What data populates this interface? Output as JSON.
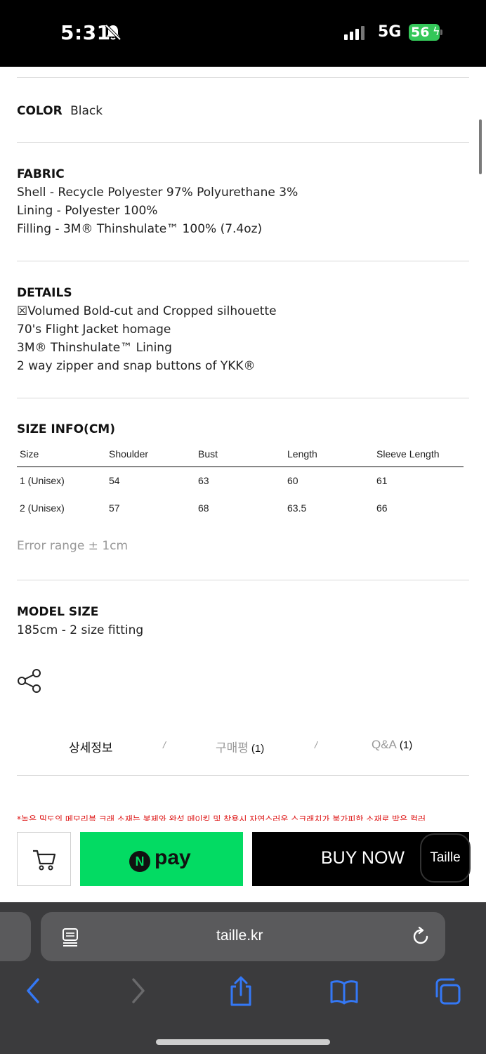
{
  "status_bar": {
    "time": "5:31",
    "network": "5G",
    "battery": "56"
  },
  "product": {
    "color_label": "COLOR",
    "color_value": "Black",
    "fabric": {
      "label": "FABRIC",
      "lines": [
        "Shell - Recycle Polyester 97% Polyurethane 3%",
        "Lining - Polyester 100%",
        "Filling - 3M® Thinshulate™ 100% (7.4oz)"
      ]
    },
    "details": {
      "label": "DETAILS",
      "lines": [
        "☒Volumed Bold-cut and Cropped silhouette",
        "70's Flight Jacket homage",
        "3M® Thinshulate™ Lining",
        "2 way zipper and snap buttons of YKK®"
      ]
    },
    "size_info": {
      "label": "SIZE INFO(CM)",
      "headers": [
        "Size",
        "Shoulder",
        "Bust",
        "Length",
        "Sleeve Length"
      ],
      "rows": [
        [
          "1 (Unisex)",
          "54",
          "63",
          "60",
          "61"
        ],
        [
          "2 (Unisex)",
          "57",
          "68",
          "63.5",
          "66"
        ]
      ],
      "note": "Error range ± 1cm"
    },
    "model_size": {
      "label": "MODEL SIZE",
      "value": "185cm - 2 size fitting"
    }
  },
  "tabs": {
    "detail": "상세정보",
    "review": "구매평",
    "review_count": "(1)",
    "qa": "Q&A",
    "qa_count": "(1)",
    "separator": "/"
  },
  "notice": "*높은 밀도의 메모리블 크래 소재는 봉제와 완성 메이킹 및 착용시 자연스러운 스크래치가 불가피한 소재로 받은 컬러",
  "purchase_bar": {
    "npay_badge": "N",
    "npay_label": "pay",
    "buy_now_label": "BUY NOW",
    "chat_label": "Taille"
  },
  "browser": {
    "url": "taille.kr"
  },
  "colors": {
    "npay_green": "#03db63",
    "buy_now_black": "#000000",
    "notice_red": "#dd1111",
    "battery_green": "#34c759",
    "ios_blue": "#3478f6"
  }
}
